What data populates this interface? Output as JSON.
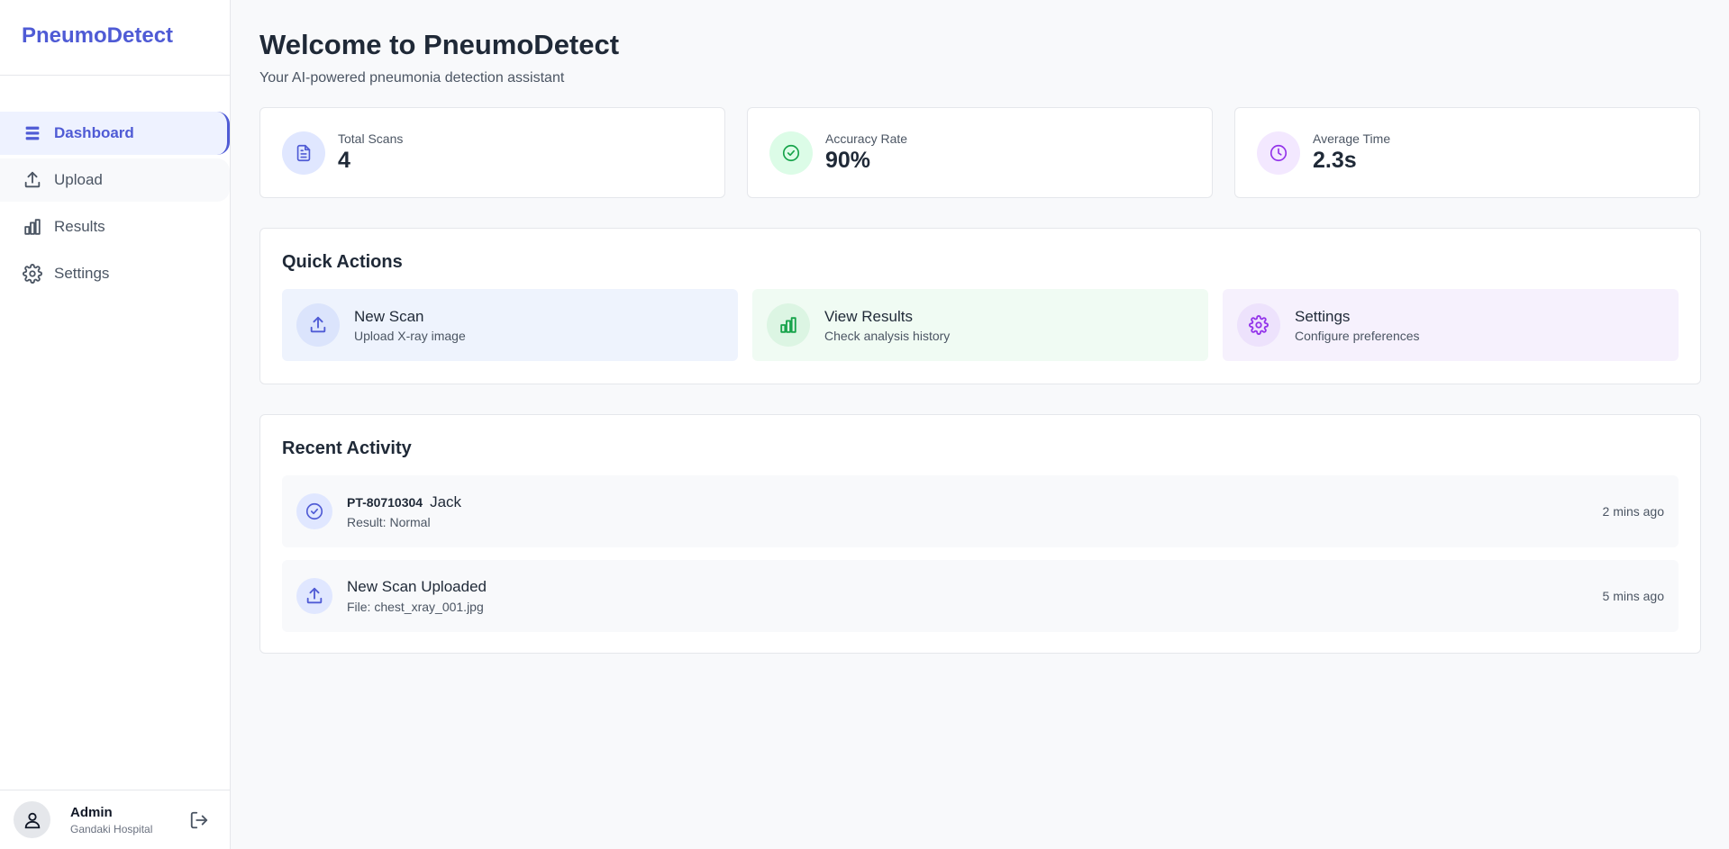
{
  "app": {
    "brand": "PneumoDetect"
  },
  "sidebar": {
    "items": [
      {
        "label": "Dashboard",
        "icon": "list-icon"
      },
      {
        "label": "Upload",
        "icon": "upload-icon"
      },
      {
        "label": "Results",
        "icon": "bar-chart-icon"
      },
      {
        "label": "Settings",
        "icon": "gear-icon"
      }
    ],
    "user": {
      "name": "Admin",
      "org": "Gandaki Hospital"
    }
  },
  "header": {
    "title": "Welcome to PneumoDetect",
    "subtitle": "Your AI-powered pneumonia detection assistant"
  },
  "stats": [
    {
      "label": "Total Scans",
      "value": "4",
      "icon": "document-icon"
    },
    {
      "label": "Accuracy Rate",
      "value": "90%",
      "icon": "check-circle-icon"
    },
    {
      "label": "Average Time",
      "value": "2.3s",
      "icon": "clock-icon"
    }
  ],
  "quick_actions": {
    "title": "Quick Actions",
    "items": [
      {
        "title": "New Scan",
        "subtitle": "Upload X-ray image",
        "icon": "upload-icon"
      },
      {
        "title": "View Results",
        "subtitle": "Check analysis history",
        "icon": "bar-chart-icon"
      },
      {
        "title": "Settings",
        "subtitle": "Configure preferences",
        "icon": "gear-icon"
      }
    ]
  },
  "recent_activity": {
    "title": "Recent Activity",
    "items": [
      {
        "code": "PT-80710304",
        "name": "Jack",
        "subtitle": "Result: Normal",
        "time": "2 mins ago",
        "icon": "check-circle-icon"
      },
      {
        "title": "New Scan Uploaded",
        "subtitle": "File: chest_xray_001.jpg",
        "time": "5 mins ago",
        "icon": "upload-icon"
      }
    ]
  },
  "colors": {
    "primary": "#4f5bd5",
    "blue_bg": "#eef3fd",
    "green_bg": "#f0fbf3",
    "purple_bg": "#f6f1fd",
    "green": "#16a34a",
    "purple": "#9333ea"
  }
}
